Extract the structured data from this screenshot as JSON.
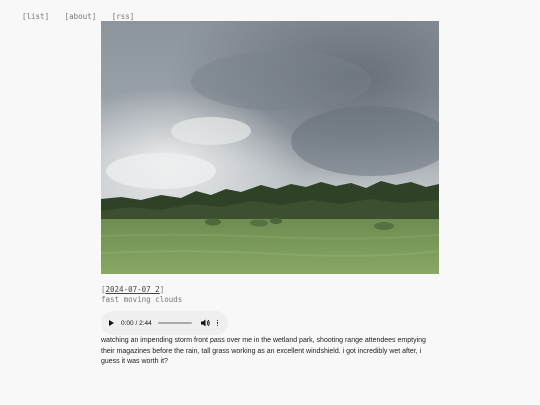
{
  "nav": {
    "list": "[list]",
    "about": "[about]",
    "rss": "[rss]"
  },
  "post": {
    "bracket_open": "[",
    "date": "2024-07-07_2",
    "bracket_close": "]",
    "title": "fast moving clouds",
    "audio": {
      "time": "0:00 / 2:44",
      "progress": 0
    },
    "description": "watching an impending storm front pass over me in the wetland park, shooting range attendees emptying their magazines before the rain, tall grass working as an excellent windshield. i got incredibly wet after, i guess it was worth it?"
  },
  "colors": {
    "background": "#f8f8f8",
    "muted_text": "#777777",
    "body_text": "#222222",
    "player_bg": "#efefef"
  },
  "icons": [
    "play-icon",
    "volume-icon",
    "more-options-icon"
  ]
}
